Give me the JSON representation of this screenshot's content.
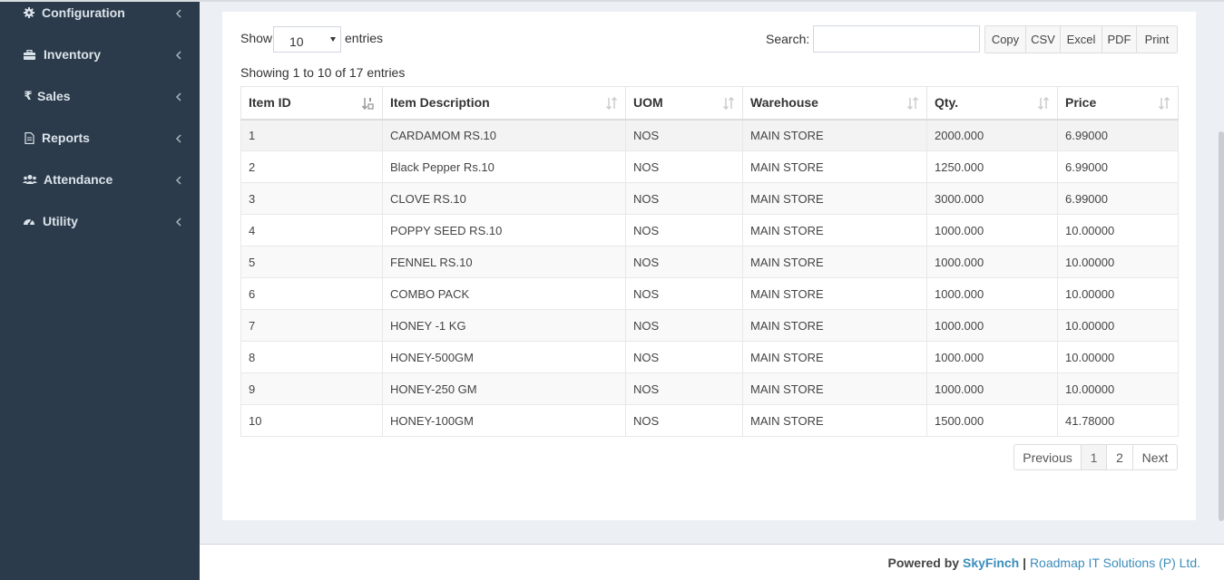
{
  "sidebar": {
    "items": [
      {
        "label": "Configuration",
        "icon": "gear-icon"
      },
      {
        "label": "Inventory",
        "icon": "briefcase-icon"
      },
      {
        "label": "Sales",
        "icon": "rupee-icon"
      },
      {
        "label": "Reports",
        "icon": "report-icon"
      },
      {
        "label": "Attendance",
        "icon": "users-icon"
      },
      {
        "label": "Utility",
        "icon": "dashboard-icon"
      }
    ]
  },
  "table_controls": {
    "show_label": "Show",
    "page_length": "10",
    "entries_label": "entries",
    "search_label": "Search:",
    "search_value": "",
    "buttons": [
      "Copy",
      "CSV",
      "Excel",
      "PDF",
      "Print"
    ],
    "info": "Showing 1 to 10 of 17 entries"
  },
  "table": {
    "headers": [
      "Item ID",
      "Item Description",
      "UOM",
      "Warehouse",
      "Qty.",
      "Price"
    ],
    "rows": [
      [
        "1",
        "CARDAMOM RS.10",
        "NOS",
        "MAIN STORE",
        "2000.000",
        "6.99000"
      ],
      [
        "2",
        "Black Pepper Rs.10",
        "NOS",
        "MAIN STORE",
        "1250.000",
        "6.99000"
      ],
      [
        "3",
        "CLOVE RS.10",
        "NOS",
        "MAIN STORE",
        "3000.000",
        "6.99000"
      ],
      [
        "4",
        "POPPY SEED RS.10",
        "NOS",
        "MAIN STORE",
        "1000.000",
        "10.00000"
      ],
      [
        "5",
        "FENNEL RS.10",
        "NOS",
        "MAIN STORE",
        "1000.000",
        "10.00000"
      ],
      [
        "6",
        "COMBO PACK",
        "NOS",
        "MAIN STORE",
        "1000.000",
        "10.00000"
      ],
      [
        "7",
        "HONEY -1 KG",
        "NOS",
        "MAIN STORE",
        "1000.000",
        "10.00000"
      ],
      [
        "8",
        "HONEY-500GM",
        "NOS",
        "MAIN STORE",
        "1000.000",
        "10.00000"
      ],
      [
        "9",
        "HONEY-250 GM",
        "NOS",
        "MAIN STORE",
        "1000.000",
        "10.00000"
      ],
      [
        "10",
        "HONEY-100GM",
        "NOS",
        "MAIN STORE",
        "1500.000",
        "41.78000"
      ]
    ]
  },
  "pagination": {
    "previous": "Previous",
    "pages": [
      "1",
      "2"
    ],
    "active_page": "1",
    "next": "Next"
  },
  "footer": {
    "powered_by": "Powered by",
    "brand": "SkyFinch",
    "separator": "|",
    "company": "Roadmap IT Solutions (P) Ltd."
  },
  "colors": {
    "sidebar_bg": "#2c3b4b",
    "link_blue": "#3c8dbc"
  }
}
